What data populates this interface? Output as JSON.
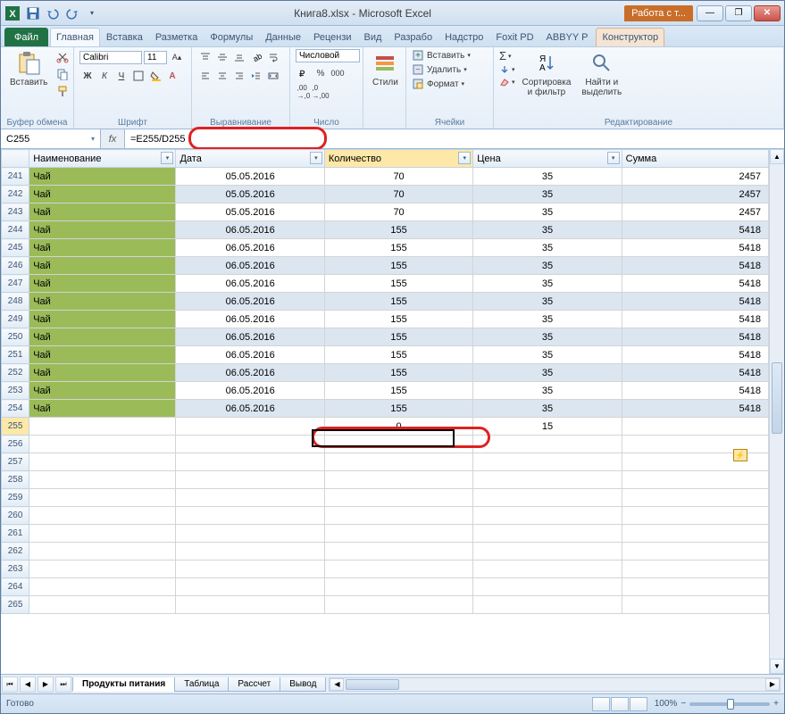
{
  "window": {
    "title": "Книга8.xlsx - Microsoft Excel",
    "contextual_tab": "Работа с т..."
  },
  "ribbon_tabs": {
    "file": "Файл",
    "items": [
      "Главная",
      "Вставка",
      "Разметка",
      "Формулы",
      "Данные",
      "Рецензи",
      "Вид",
      "Разрабо",
      "Надстро",
      "Foxit PD",
      "ABBYY P"
    ],
    "active": "Главная",
    "ctx": "Конструктор"
  },
  "ribbon": {
    "clipboard": {
      "paste": "Вставить",
      "label": "Буфер обмена"
    },
    "font": {
      "name": "Calibri",
      "size": "11",
      "label": "Шрифт"
    },
    "alignment": {
      "label": "Выравнивание"
    },
    "number": {
      "format": "Числовой",
      "label": "Число"
    },
    "styles": {
      "btn": "Стили",
      "label": ""
    },
    "cells": {
      "insert": "Вставить",
      "delete": "Удалить",
      "format": "Формат",
      "label": "Ячейки"
    },
    "editing": {
      "sort": "Сортировка\nи фильтр",
      "find": "Найти и\nвыделить",
      "label": "Редактирование"
    }
  },
  "namebox": "C255",
  "formula": "=E255/D255",
  "columns": [
    "Наименование",
    "Дата",
    "Количество",
    "Цена",
    "Сумма"
  ],
  "rows": [
    {
      "n": 241,
      "name": "Чай",
      "date": "05.05.2016",
      "qty": "70",
      "price": "35",
      "sum": "2457",
      "band": false
    },
    {
      "n": 242,
      "name": "Чай",
      "date": "05.05.2016",
      "qty": "70",
      "price": "35",
      "sum": "2457",
      "band": true
    },
    {
      "n": 243,
      "name": "Чай",
      "date": "05.05.2016",
      "qty": "70",
      "price": "35",
      "sum": "2457",
      "band": false
    },
    {
      "n": 244,
      "name": "Чай",
      "date": "06.05.2016",
      "qty": "155",
      "price": "35",
      "sum": "5418",
      "band": true
    },
    {
      "n": 245,
      "name": "Чай",
      "date": "06.05.2016",
      "qty": "155",
      "price": "35",
      "sum": "5418",
      "band": false
    },
    {
      "n": 246,
      "name": "Чай",
      "date": "06.05.2016",
      "qty": "155",
      "price": "35",
      "sum": "5418",
      "band": true
    },
    {
      "n": 247,
      "name": "Чай",
      "date": "06.05.2016",
      "qty": "155",
      "price": "35",
      "sum": "5418",
      "band": false
    },
    {
      "n": 248,
      "name": "Чай",
      "date": "06.05.2016",
      "qty": "155",
      "price": "35",
      "sum": "5418",
      "band": true
    },
    {
      "n": 249,
      "name": "Чай",
      "date": "06.05.2016",
      "qty": "155",
      "price": "35",
      "sum": "5418",
      "band": false
    },
    {
      "n": 250,
      "name": "Чай",
      "date": "06.05.2016",
      "qty": "155",
      "price": "35",
      "sum": "5418",
      "band": true
    },
    {
      "n": 251,
      "name": "Чай",
      "date": "06.05.2016",
      "qty": "155",
      "price": "35",
      "sum": "5418",
      "band": false
    },
    {
      "n": 252,
      "name": "Чай",
      "date": "06.05.2016",
      "qty": "155",
      "price": "35",
      "sum": "5418",
      "band": true
    },
    {
      "n": 253,
      "name": "Чай",
      "date": "06.05.2016",
      "qty": "155",
      "price": "35",
      "sum": "5418",
      "band": false
    },
    {
      "n": 254,
      "name": "Чай",
      "date": "06.05.2016",
      "qty": "155",
      "price": "35",
      "sum": "5418",
      "band": true
    },
    {
      "n": 255,
      "name": "",
      "date": "",
      "qty": "0",
      "price": "15",
      "sum": "",
      "band": false,
      "sel": true
    }
  ],
  "empty_rows": [
    256,
    257,
    258,
    259,
    260,
    261,
    262,
    263,
    264,
    265
  ],
  "sheets": {
    "active": "Продукты питания",
    "others": [
      "Таблица",
      "Рассчет",
      "Вывод"
    ]
  },
  "status": {
    "ready": "Готово",
    "zoom": "100%"
  }
}
